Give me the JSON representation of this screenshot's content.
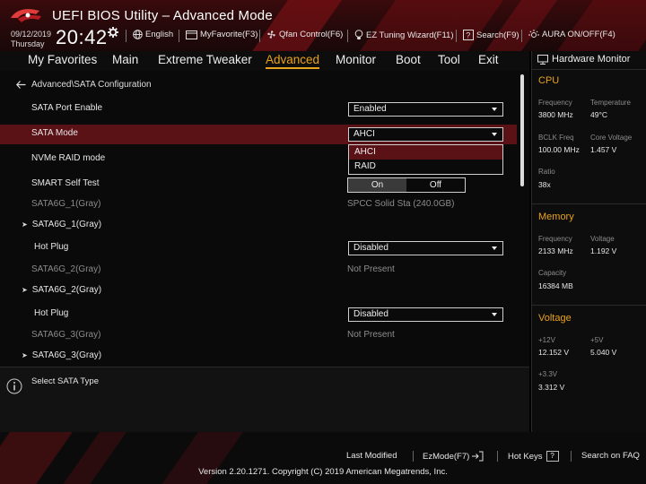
{
  "header": {
    "title": "UEFI BIOS Utility – Advanced Mode",
    "date": "09/12/2019",
    "weekday": "Thursday",
    "time": "20:42",
    "items": [
      {
        "label": "English",
        "icon": "globe-icon"
      },
      {
        "label": "MyFavorite(F3)",
        "icon": "favorite-icon"
      },
      {
        "label": "Qfan Control(F6)",
        "icon": "fan-icon"
      },
      {
        "label": "EZ Tuning Wizard(F11)",
        "icon": "bulb-icon"
      },
      {
        "label": "Search(F9)",
        "icon": "search-icon"
      },
      {
        "label": "AURA ON/OFF(F4)",
        "icon": "aura-icon"
      }
    ]
  },
  "menu": {
    "tabs": [
      "My Favorites",
      "Main",
      "Extreme Tweaker",
      "Advanced",
      "Monitor",
      "Boot",
      "Tool",
      "Exit"
    ],
    "active": "Advanced"
  },
  "main": {
    "breadcrumb": "Advanced\\SATA Configuration",
    "sata_port_enable": {
      "label": "SATA Port Enable",
      "value": "Enabled"
    },
    "sata_mode": {
      "label": "SATA Mode",
      "value": "AHCI",
      "options": [
        "AHCI",
        "RAID"
      ],
      "selected": "AHCI"
    },
    "nvme_raid": {
      "label": "NVMe RAID mode"
    },
    "smart_self_test": {
      "label": "SMART Self Test",
      "on": "On",
      "off": "Off",
      "state": "On"
    },
    "sata1_info": {
      "label": "SATA6G_1(Gray)",
      "value": "SPCC Solid Sta (240.0GB)"
    },
    "sata1_expand": {
      "label": "SATA6G_1(Gray)"
    },
    "hotplug1": {
      "label": "Hot Plug",
      "value": "Disabled"
    },
    "sata2_info": {
      "label": "SATA6G_2(Gray)",
      "value": "Not Present"
    },
    "sata2_expand": {
      "label": "SATA6G_2(Gray)"
    },
    "hotplug2": {
      "label": "Hot Plug",
      "value": "Disabled"
    },
    "sata3_info": {
      "label": "SATA6G_3(Gray)",
      "value": "Not Present"
    },
    "sata3_expand": {
      "label": "SATA6G_3(Gray)"
    }
  },
  "help": {
    "text": "Select SATA Type"
  },
  "hardware_monitor": {
    "title": "Hardware Monitor",
    "cpu": {
      "heading": "CPU",
      "frequency_label": "Frequency",
      "frequency": "3800 MHz",
      "temperature_label": "Temperature",
      "temperature": "49°C",
      "bclk_label": "BCLK Freq",
      "bclk": "100.00 MHz",
      "core_voltage_label": "Core Voltage",
      "core_voltage": "1.457 V",
      "ratio_label": "Ratio",
      "ratio": "38x"
    },
    "memory": {
      "heading": "Memory",
      "frequency_label": "Frequency",
      "frequency": "2133 MHz",
      "voltage_label": "Voltage",
      "voltage": "1.192 V",
      "capacity_label": "Capacity",
      "capacity": "16384 MB"
    },
    "voltage": {
      "heading": "Voltage",
      "v12_label": "+12V",
      "v12": "12.152 V",
      "v5_label": "+5V",
      "v5": "5.040 V",
      "v33_label": "+3.3V",
      "v33": "3.312 V"
    }
  },
  "footer": {
    "last_modified": "Last Modified",
    "ezmode": "EzMode(F7)",
    "hotkeys": "Hot Keys",
    "hotkeys_key": "?",
    "search_faq": "Search on FAQ",
    "copyright": "Version 2.20.1271. Copyright (C) 2019 American Megatrends, Inc."
  },
  "colors": {
    "accent": "#e9a21b",
    "highlight": "#5a1217",
    "header_red": "#8b1218"
  }
}
